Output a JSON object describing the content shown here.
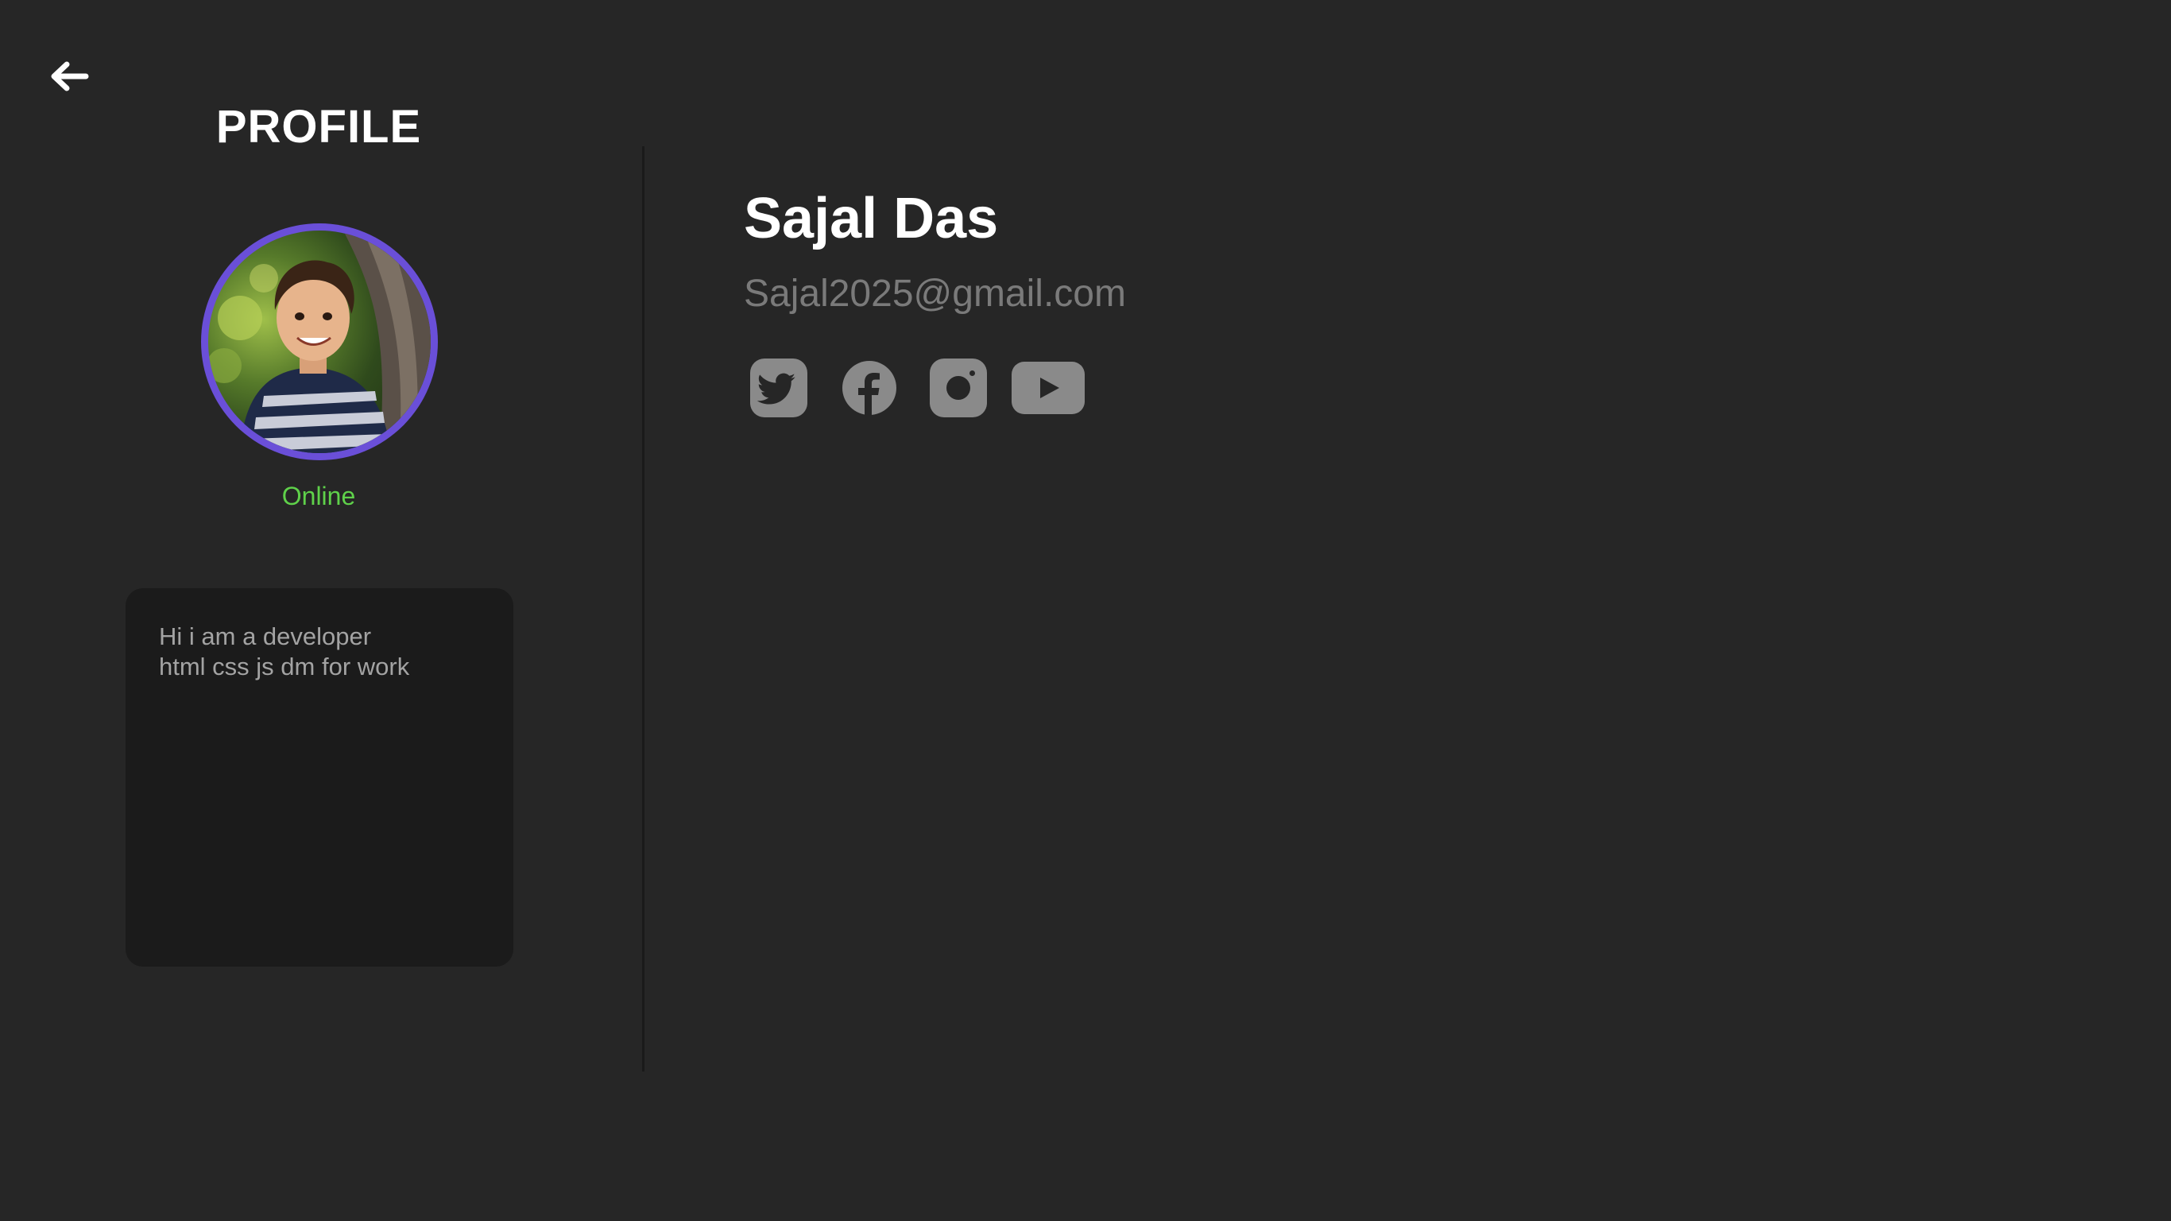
{
  "header": {
    "back_icon": "arrow-left-icon",
    "title": "PROFILE"
  },
  "profile": {
    "status": "Online",
    "status_color": "#5fd14a",
    "avatar_ring_color": "#6a4fd8",
    "bio_lines": [
      "Hi i am a developer",
      "html css js dm for work"
    ]
  },
  "details": {
    "name": "Sajal Das",
    "email": "Sajal2025@gmail.com",
    "socials": [
      {
        "icon": "twitter-icon"
      },
      {
        "icon": "facebook-icon"
      },
      {
        "icon": "instagram-icon"
      },
      {
        "icon": "youtube-icon"
      }
    ]
  },
  "colors": {
    "background": "#262626",
    "card": "#1b1b1b",
    "icon": "#8a8a8a"
  }
}
